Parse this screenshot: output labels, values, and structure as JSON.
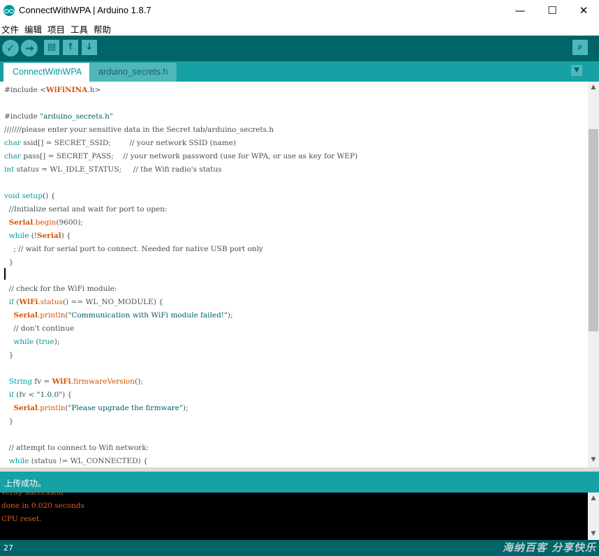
{
  "window": {
    "title": "ConnectWithWPA | Arduino 1.8.7",
    "minimize": "—",
    "maximize": "☐",
    "close": "✕"
  },
  "menu": [
    "文件",
    "编辑",
    "项目",
    "工具",
    "帮助"
  ],
  "toolbar": {
    "verify": "✓",
    "upload": "→",
    "new": "▤",
    "open": "↑",
    "save": "↓",
    "monitor": "⌕"
  },
  "tabs": [
    "ConnectWithWPA",
    "arduino_secrets.h"
  ],
  "tab_menu": "▼",
  "status": "上传成功。",
  "console": [
    "verify successful",
    "done in 0.020 seconds",
    "CPU reset."
  ],
  "line_number": "27",
  "watermark": "海纳百客 分享快乐",
  "colors": {
    "teal_dark": "#006468",
    "teal": "#17a1a5",
    "orange": "#d35400"
  }
}
